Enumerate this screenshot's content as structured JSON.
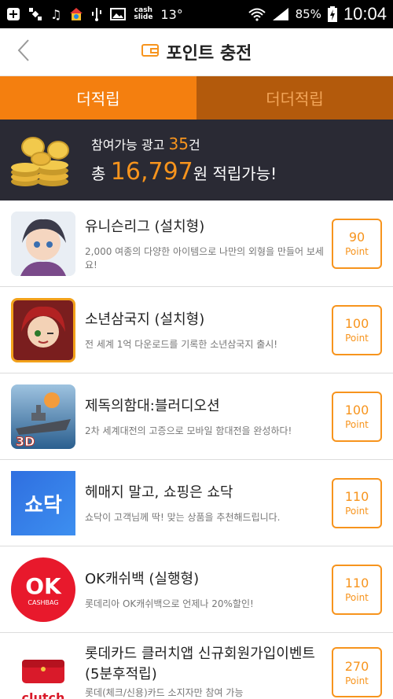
{
  "status_bar": {
    "cash_label": "cash\nslide",
    "temperature": "13°",
    "battery": "85%",
    "time": "10:04"
  },
  "header": {
    "title": "포인트 충전"
  },
  "tabs": [
    {
      "label": "더적립",
      "active": true
    },
    {
      "label": "더더적립",
      "active": false
    }
  ],
  "summary": {
    "ads_prefix": "참여가능 광고 ",
    "ads_count": "35",
    "ads_suffix": "건",
    "total_prefix": "총 ",
    "total_amount": "16,797",
    "total_suffix": "원 적립가능!"
  },
  "offers": [
    {
      "title": "유니슨리그 (설치형)",
      "desc": "2,000 여종의 다양한 아이템으로 나만의 외형을 만들어 보세요!",
      "points": "90",
      "unit": "Point",
      "icon": "game-character-icon"
    },
    {
      "title": "소년삼국지 (설치형)",
      "desc": "전 세계 1억 다운로드를 기록한 소년삼국지 출시!",
      "points": "100",
      "unit": "Point",
      "icon": "game-hero-icon"
    },
    {
      "title": "제독의함대:블러디오션",
      "desc": "2차 세계대전의 고증으로 모바일 함대전을 완성하다!",
      "points": "100",
      "unit": "Point",
      "icon": "battleship-icon"
    },
    {
      "title": "헤매지 말고, 쇼핑은 쇼닥",
      "desc": "쇼닥이 고객님께 딱! 맞는 상품을 추천해드립니다.",
      "points": "110",
      "unit": "Point",
      "icon": "shodak-logo-icon"
    },
    {
      "title": "OK캐쉬백 (실행형)",
      "desc": "롯데리아 OK캐쉬백으로 언제나 20%할인!",
      "points": "110",
      "unit": "Point",
      "icon": "ok-cashbag-logo-icon"
    },
    {
      "title": "롯데카드 클러치앱 신규회원가입이벤트 (5분후적립)",
      "desc": "롯데(체크/신용)카드 소지자만 참여 가능",
      "points": "270",
      "unit": "Point",
      "icon": "clutch-wallet-icon"
    }
  ],
  "thumb_labels": {
    "game_3d": "3D",
    "shodak": "쇼닥",
    "ok": "OK",
    "cashbag": "CASHBAG",
    "clutch": "clutch"
  }
}
